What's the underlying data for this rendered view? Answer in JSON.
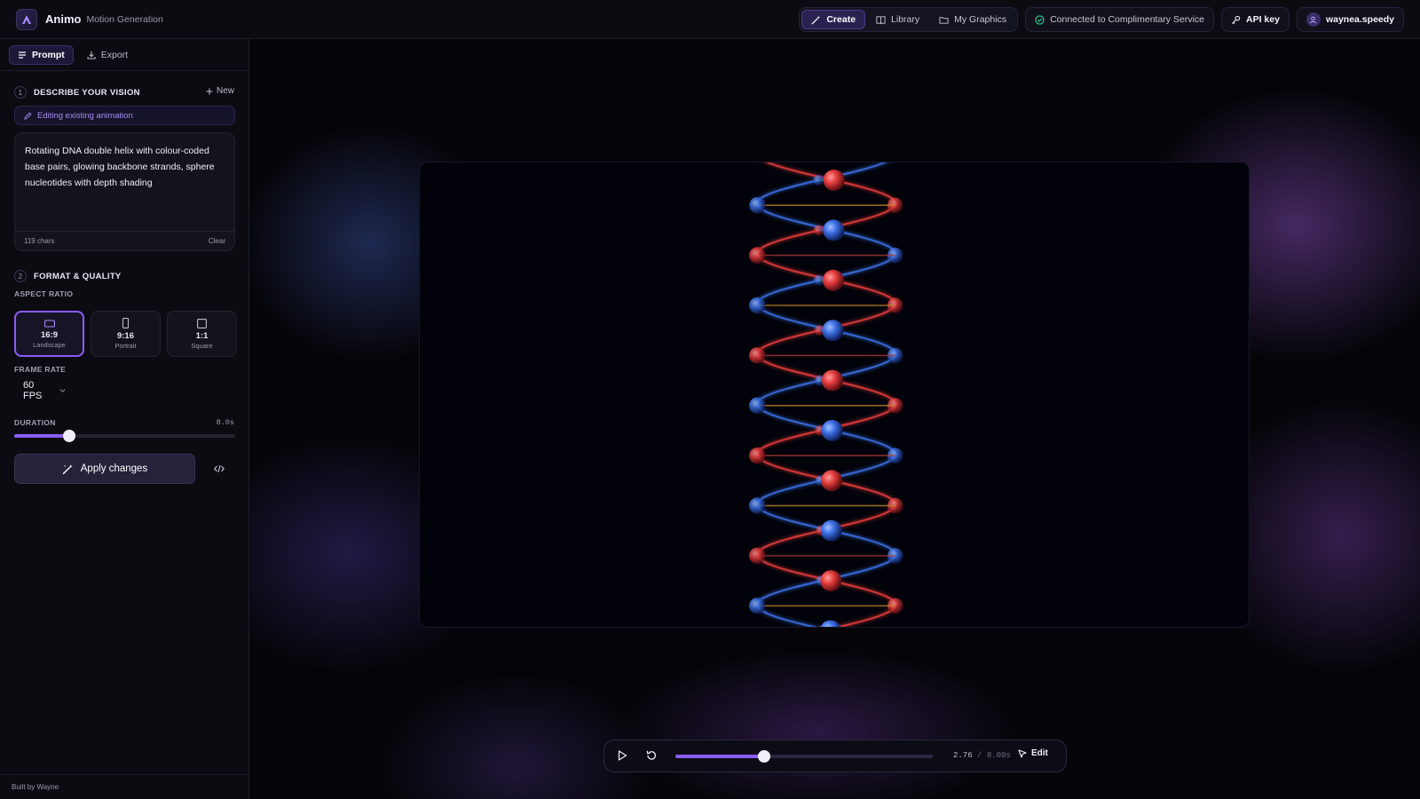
{
  "header": {
    "app_name": "Animo",
    "app_subtitle": "Motion Generation",
    "nav": [
      {
        "label": "Create",
        "icon": "wand-icon",
        "active": true
      },
      {
        "label": "Library",
        "icon": "book-icon",
        "active": false
      },
      {
        "label": "My Graphics",
        "icon": "folder-icon",
        "active": false
      }
    ],
    "connection_status": "Connected to Complimentary Service",
    "api_key_label": "API key",
    "username": "waynea.speedy"
  },
  "sidebar": {
    "tabs": [
      {
        "label": "Prompt",
        "icon": "menu-icon",
        "active": true
      },
      {
        "label": "Export",
        "icon": "download-icon",
        "active": false
      }
    ],
    "describe": {
      "step": "1",
      "title": "DESCRIBE YOUR VISION",
      "new_label": "New",
      "editing_banner": "Editing existing animation",
      "prompt_text": "Rotating DNA double helix with colour-coded base pairs, glowing backbone strands, sphere nucleotides with depth shading",
      "char_count": "119 chars",
      "clear_label": "Clear"
    },
    "format": {
      "step": "2",
      "title": "FORMAT & QUALITY",
      "aspect_label": "ASPECT RATIO",
      "aspect_options": [
        {
          "value": "16:9",
          "name": "Landscape",
          "selected": true
        },
        {
          "value": "9:16",
          "name": "Portrait",
          "selected": false
        },
        {
          "value": "1:1",
          "name": "Square",
          "selected": false
        }
      ],
      "frame_rate_label": "FRAME RATE",
      "frame_rate_value": "60 FPS",
      "duration_label": "DURATION",
      "duration_value": "8.0s",
      "duration_fill_fraction": 0.25
    },
    "apply_label": "Apply changes",
    "footer": "Built by Wayne"
  },
  "player": {
    "current_time": "2.76",
    "separator": "/",
    "total_time": "8.00s",
    "progress_fraction": 0.345,
    "edit_label": "Edit"
  },
  "colors": {
    "accent": "#8b5cf6",
    "strand_red": "#e23b3b",
    "strand_blue": "#3b6ee2"
  }
}
